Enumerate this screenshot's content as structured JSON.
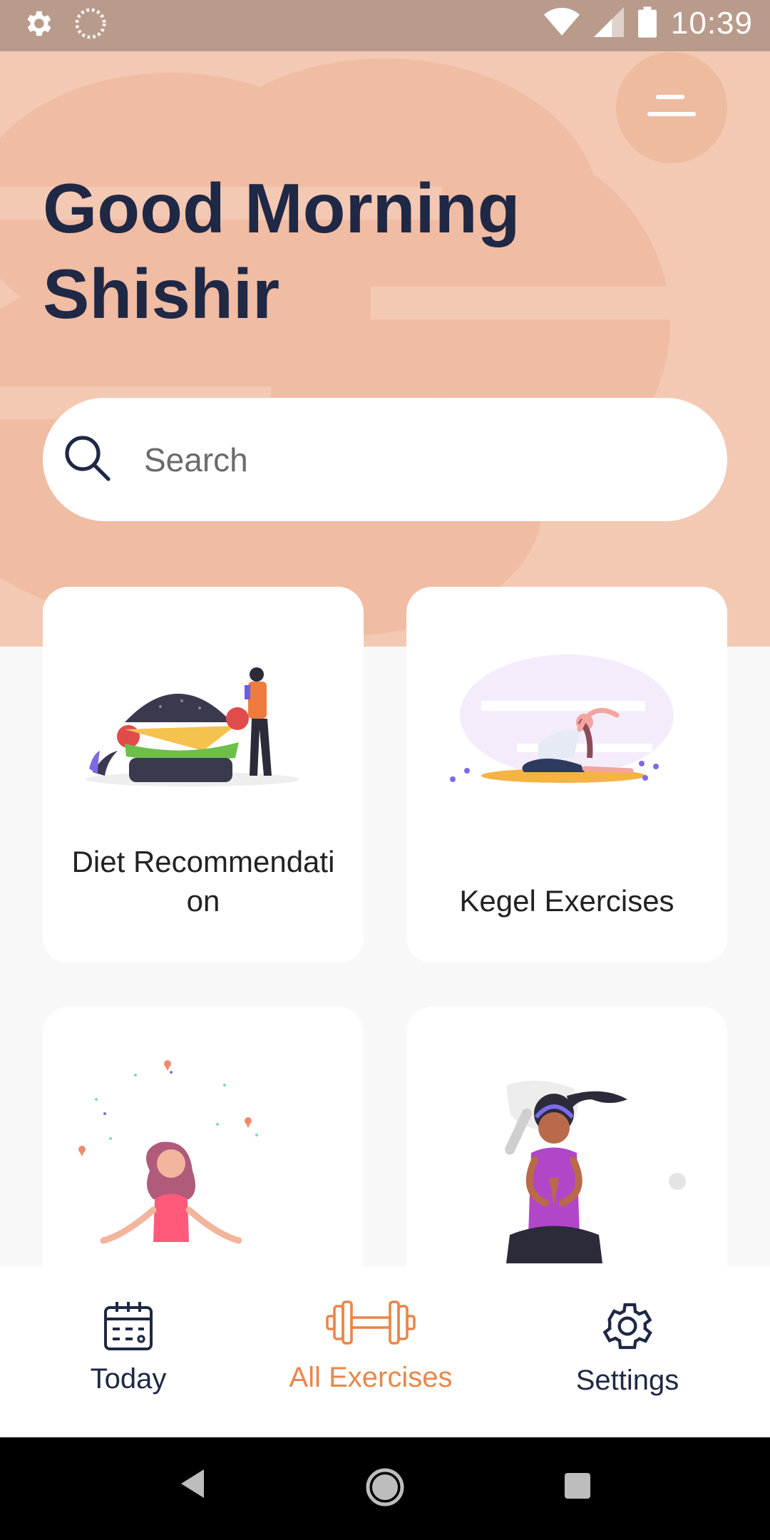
{
  "status_bar": {
    "time": "10:39",
    "left_icons": [
      "gear-icon",
      "loading-spinner-icon"
    ],
    "right_icons": [
      "wifi-icon",
      "cellular-signal-icon",
      "battery-icon"
    ]
  },
  "header": {
    "greeting": "Good Morning Shishir",
    "menu_icon": "menu-icon"
  },
  "search": {
    "placeholder": "Search",
    "value": ""
  },
  "cards": [
    {
      "title": "Diet Recommendation",
      "illustration": "burger-person-illustration"
    },
    {
      "title": "Kegel Exercises",
      "illustration": "yoga-stretch-illustration"
    },
    {
      "title": "",
      "illustration": "meditation-illustration"
    },
    {
      "title": "",
      "illustration": "yoga-namaste-illustration"
    }
  ],
  "bottom_nav": {
    "items": [
      {
        "label": "Today",
        "icon": "calendar-icon",
        "active": false
      },
      {
        "label": "All Exercises",
        "icon": "dumbbell-icon",
        "active": true
      },
      {
        "label": "Settings",
        "icon": "gear-icon",
        "active": false
      }
    ]
  },
  "system_nav": [
    "back-icon",
    "home-icon",
    "recents-icon"
  ],
  "colors": {
    "status_bar": "#b99b8c",
    "hero": "#f3c9b3",
    "heading": "#1f2845",
    "accent": "#e8874a"
  }
}
